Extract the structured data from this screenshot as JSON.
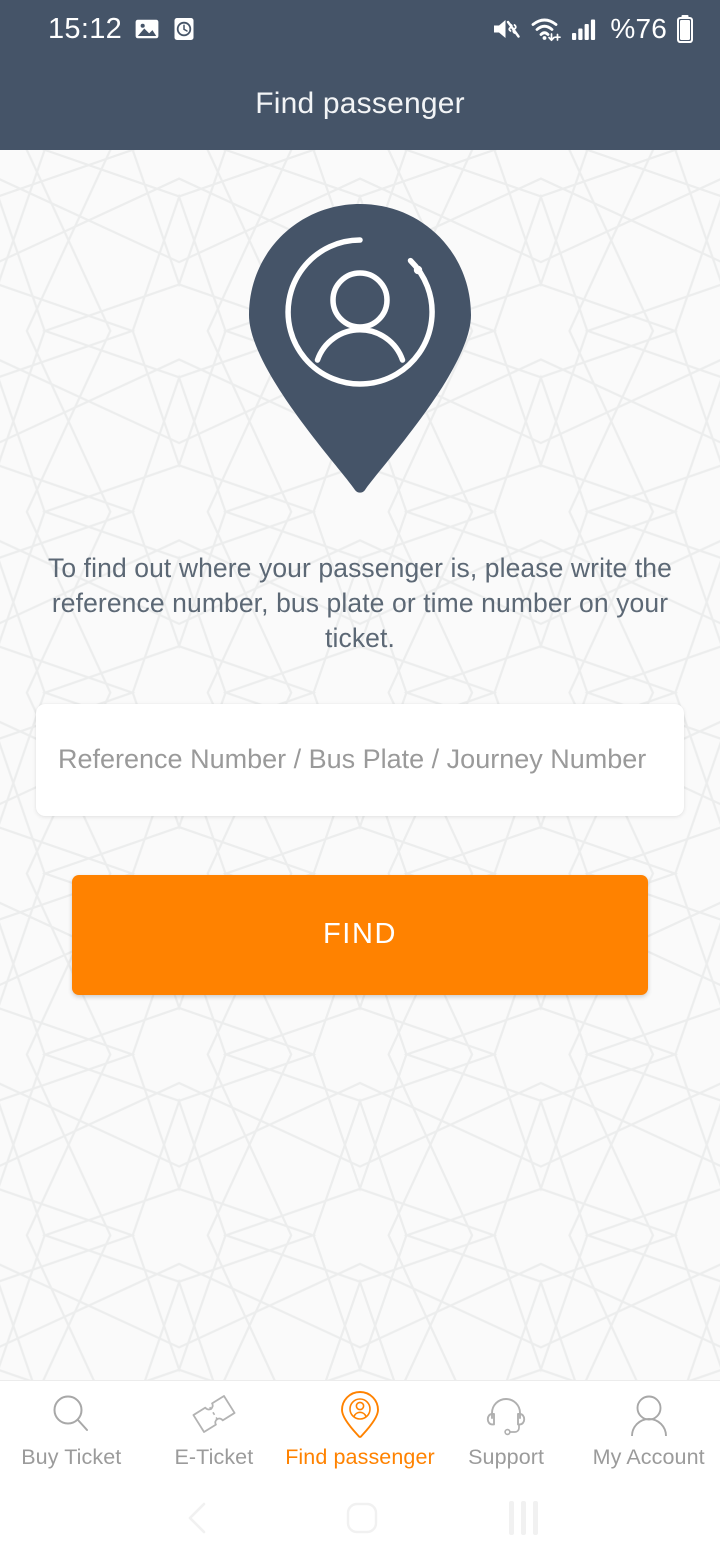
{
  "status_bar": {
    "time": "15:12",
    "battery_text": "%76",
    "icons": [
      "gallery-icon",
      "alarm-clock-icon",
      "mute-icon",
      "wifi-icon",
      "signal-bars-icon",
      "battery-icon"
    ]
  },
  "header": {
    "title": "Find passenger"
  },
  "hero": {
    "icon": "map-pin-passenger-icon"
  },
  "main": {
    "description": "To find out where your passenger is, please write the reference number, bus plate or time number on your ticket.",
    "search_placeholder": "Reference Number / Bus Plate / Journey Number",
    "search_value": "",
    "find_button_label": "FIND"
  },
  "bottom_nav": {
    "items": [
      {
        "label": "Buy Ticket",
        "icon": "magnifier-icon",
        "active": false
      },
      {
        "label": "E-Ticket",
        "icon": "ticket-icon",
        "active": false
      },
      {
        "label": "Find passenger",
        "icon": "map-pin-passenger-icon",
        "active": true
      },
      {
        "label": "Support",
        "icon": "headset-icon",
        "active": false
      },
      {
        "label": "My Account",
        "icon": "person-icon",
        "active": false
      }
    ]
  },
  "android_nav": {
    "back": "back-chevron-icon",
    "home": "home-square-icon",
    "recents": "recents-bars-icon"
  },
  "colors": {
    "header": "#455468",
    "accent": "#FF8200",
    "content_bg": "#fafafa",
    "muted_text": "#9b9b9b",
    "body_text": "#5c6875"
  }
}
